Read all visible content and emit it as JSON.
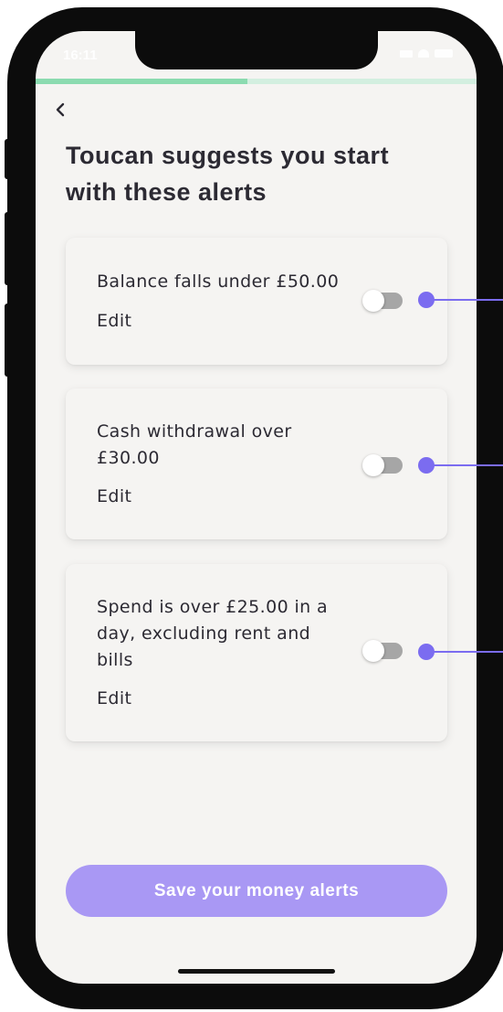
{
  "status_bar": {
    "time": "16:11"
  },
  "onboarding": {
    "progress": 0.48
  },
  "header": {
    "title": "Toucan suggests you start with these alerts"
  },
  "alerts": [
    {
      "label": "Balance falls under £50.00",
      "edit_label": "Edit",
      "enabled": false
    },
    {
      "label": "Cash withdrawal over £30.00",
      "edit_label": "Edit",
      "enabled": false
    },
    {
      "label": "Spend is over £25.00 in a day, excluding rent and bills",
      "edit_label": "Edit",
      "enabled": false
    }
  ],
  "footer": {
    "save_label": "Save your money alerts"
  },
  "colors": {
    "background": "#f5f4f2",
    "text": "#2c2a33",
    "progress_fill": "#8bdbb0",
    "progress_track": "#d3efe0",
    "primary_button": "#a998f4",
    "toggle_off": "#a6a6a6",
    "annotation": "#7b6cf0"
  },
  "icons": {
    "back": "chevron-left-icon",
    "signal": "signal-icon",
    "wifi": "wifi-icon",
    "battery": "battery-icon",
    "location": "location-arrow-icon"
  }
}
